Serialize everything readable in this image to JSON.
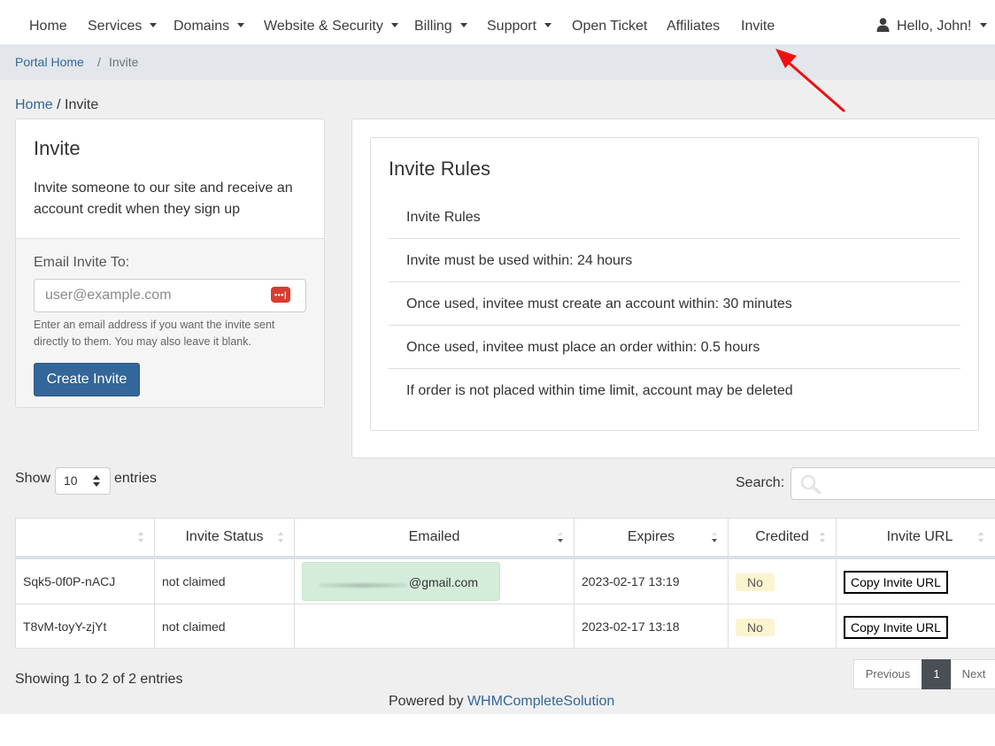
{
  "nav": {
    "items": [
      {
        "label": "Home",
        "caret": false
      },
      {
        "label": "Services",
        "caret": true
      },
      {
        "label": "Domains",
        "caret": true
      },
      {
        "label": "Website & Security",
        "caret": true
      },
      {
        "label": "Billing",
        "caret": true
      },
      {
        "label": "Support",
        "caret": true
      },
      {
        "label": "Open Ticket",
        "caret": false
      },
      {
        "label": "Affiliates",
        "caret": false
      },
      {
        "label": "Invite",
        "caret": false
      }
    ],
    "user_greeting": "Hello, John!"
  },
  "breadcrumb": {
    "home": "Portal Home",
    "separator": "/",
    "current": "Invite"
  },
  "page_crumb": {
    "home": "Home",
    "current": "/ Invite"
  },
  "invite_card": {
    "title": "Invite",
    "description": "Invite someone to our site and receive an account credit when they sign up",
    "email_label": "Email Invite To:",
    "email_placeholder": "user@example.com",
    "email_help": "Enter an email address if you want the invite sent directly to them. You may also leave it blank.",
    "create_button": "Create Invite",
    "password_icon": "•••|"
  },
  "rules": {
    "title": "Invite Rules",
    "items": [
      "Invite Rules",
      "Invite must be used within: 24 hours",
      "Once used, invitee must create an account within: 30 minutes",
      "Once used, invitee must place an order within: 0.5 hours",
      "If order is not placed within time limit, account may be deleted"
    ]
  },
  "table_controls": {
    "show_label": "Show",
    "entries_label": "entries",
    "page_length": "10",
    "search_label": "Search:"
  },
  "table": {
    "columns": [
      "",
      "Invite Status",
      "Emailed",
      "Expires",
      "Credited",
      "Invite URL"
    ],
    "rows": [
      {
        "code": "Sqk5-0f0P-nACJ",
        "status": "not claimed",
        "emailed": "@gmail.com",
        "expires": "2023-02-17 13:19",
        "credited": "No",
        "url_button": "Copy Invite URL"
      },
      {
        "code": "T8vM-toyY-zjYt",
        "status": "not claimed",
        "emailed": "",
        "expires": "2023-02-17 13:18",
        "credited": "No",
        "url_button": "Copy Invite URL"
      }
    ]
  },
  "table_info": "Showing 1 to 2 of 2 entries",
  "pagination": {
    "previous": "Previous",
    "current": "1",
    "next": "Next"
  },
  "footer": {
    "powered_by": "Powered by",
    "link": "WHMCompleteSolution"
  },
  "colors": {
    "primary": "#336699",
    "annotation_arrow": "#ee1111",
    "badge_bg": "#fcf3cf",
    "email_highlight": "#d4edda"
  }
}
